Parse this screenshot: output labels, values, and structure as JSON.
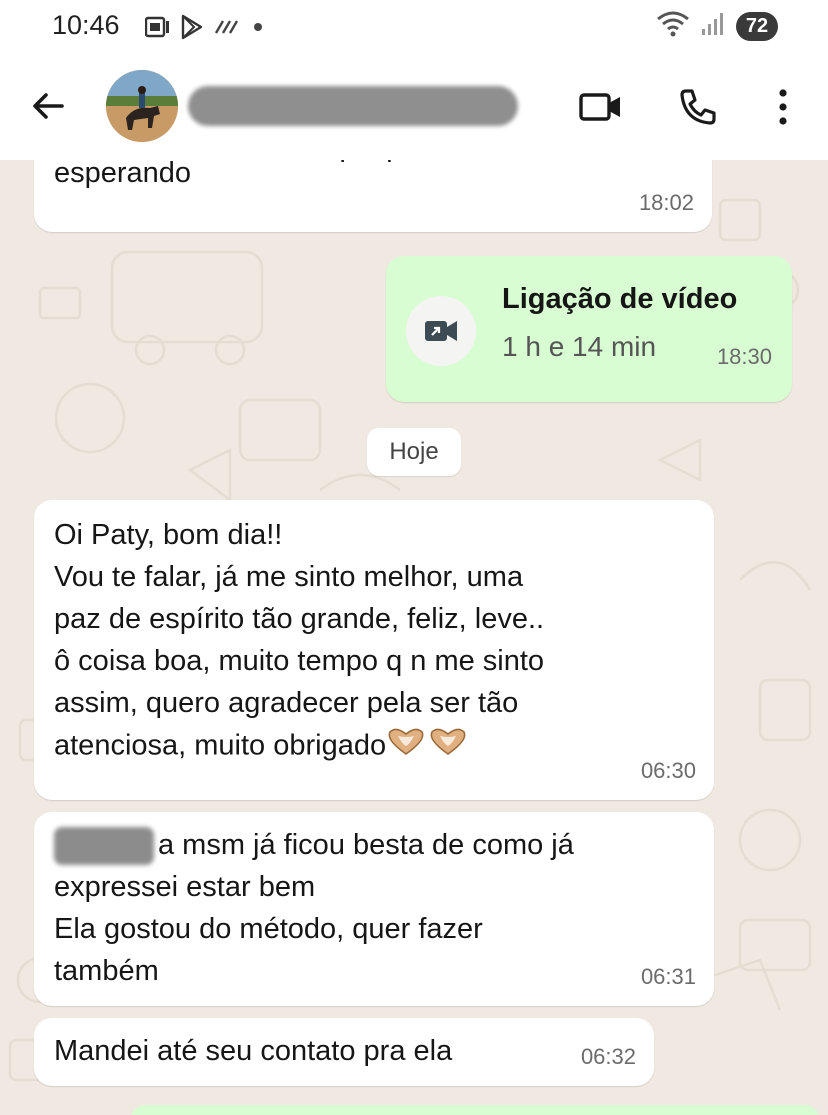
{
  "status_bar": {
    "time": "10:46",
    "battery": "72",
    "notification_icons": [
      "gallery-icon",
      "play-store-icon",
      "wifi-calling-icon",
      "dot-icon"
    ]
  },
  "header": {
    "contact_name": "",
    "actions": [
      "video-call",
      "voice-call",
      "more-options"
    ]
  },
  "messages": [
    {
      "id": "m1",
      "direction": "incoming",
      "partial_line": "eu estou no local to aqui quietinho",
      "text": "esperando",
      "time": "18:02"
    },
    {
      "id": "m2",
      "direction": "outgoing",
      "type": "video_call",
      "title": "Ligação de vídeo",
      "duration": "1 h e 14 min",
      "time": "18:30"
    },
    {
      "id": "m3",
      "direction": "incoming",
      "text": "Oi Paty, bom dia!!\nVou te falar, já me sinto melhor, uma\npaz de espírito tão grande, feliz, leve..\nô coisa boa, muito tempo q n me sinto\nassim, quero agradecer pela ser tão\natenciosa, muito obrigado",
      "emoji": "heart-hands",
      "time": "06:30"
    },
    {
      "id": "m4",
      "direction": "incoming",
      "text_first_line": "a msm já ficou besta de como já",
      "text": "expressei estar bem\nEla gostou do método, quer fazer\ntambém",
      "time": "06:31"
    },
    {
      "id": "m5",
      "direction": "incoming",
      "text": "Mandei até seu contato pra ela",
      "time": "06:32"
    }
  ],
  "date_separator": "Hoje",
  "colors": {
    "chat_background": "#efe9e1",
    "incoming_bubble": "#ffffff",
    "outgoing_bubble": "#d9fdd3",
    "header_background": "#ffffff"
  }
}
